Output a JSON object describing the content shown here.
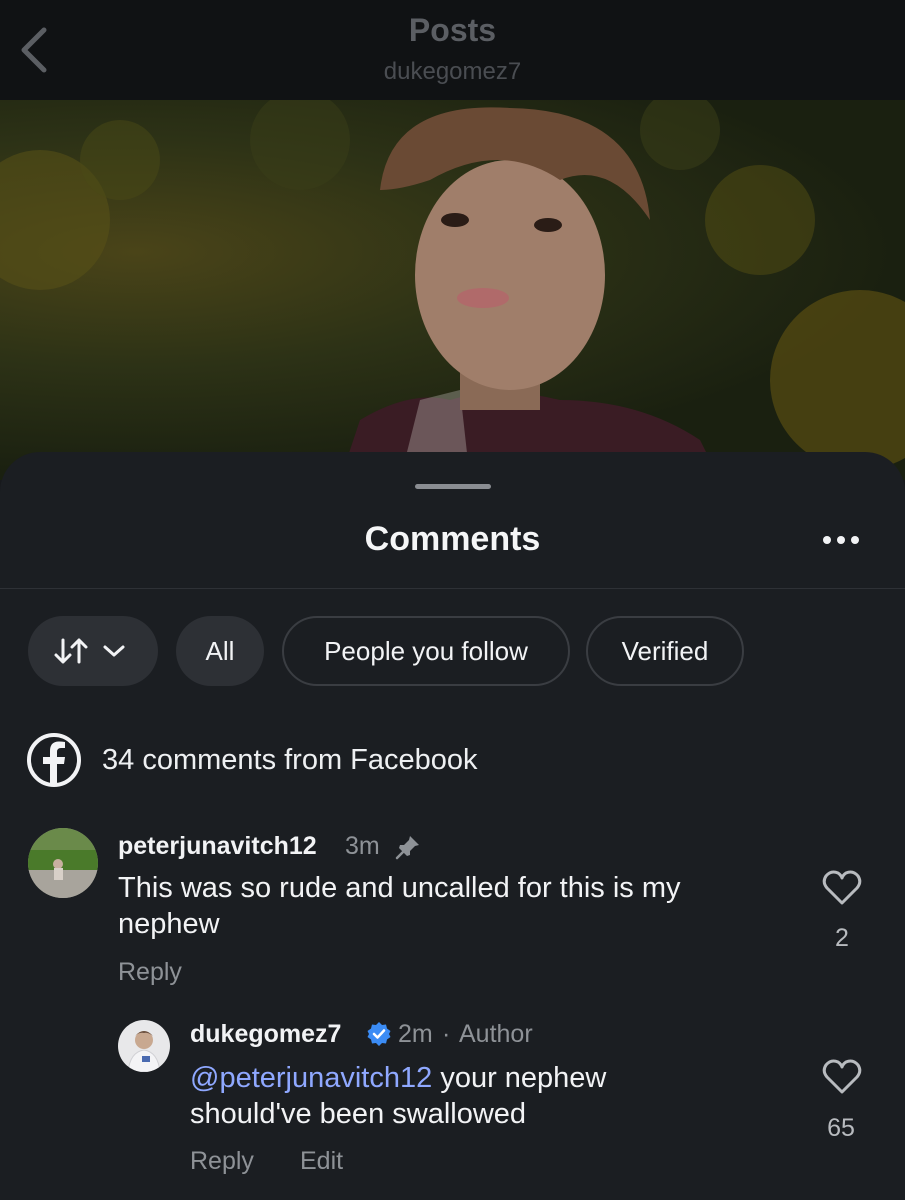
{
  "header": {
    "title": "Posts",
    "username": "dukegomez7"
  },
  "sheet": {
    "title": "Comments"
  },
  "filters": {
    "all": "All",
    "people_you_follow": "People you follow",
    "verified": "Verified"
  },
  "facebook_notice": "34 comments from Facebook",
  "comments": [
    {
      "username": "peterjunavitch12",
      "time": "3m",
      "text_line1": "This was so rude and uncalled for this is my",
      "text_line2": "nephew",
      "reply_label": "Reply",
      "likes": "2"
    }
  ],
  "reply": {
    "username": "dukegomez7",
    "time": "2m",
    "separator": "·",
    "author_label": "Author",
    "mention": "@peterjunavitch12",
    "text_line1_rest": " your nephew",
    "text_line2": "should've been swallowed",
    "reply_label": "Reply",
    "edit_label": "Edit",
    "likes": "65"
  },
  "colors": {
    "background": "#17191c",
    "sheet": "#1b1e22",
    "verified_badge": "#3b8cf5",
    "mention": "#8fa8ff"
  }
}
